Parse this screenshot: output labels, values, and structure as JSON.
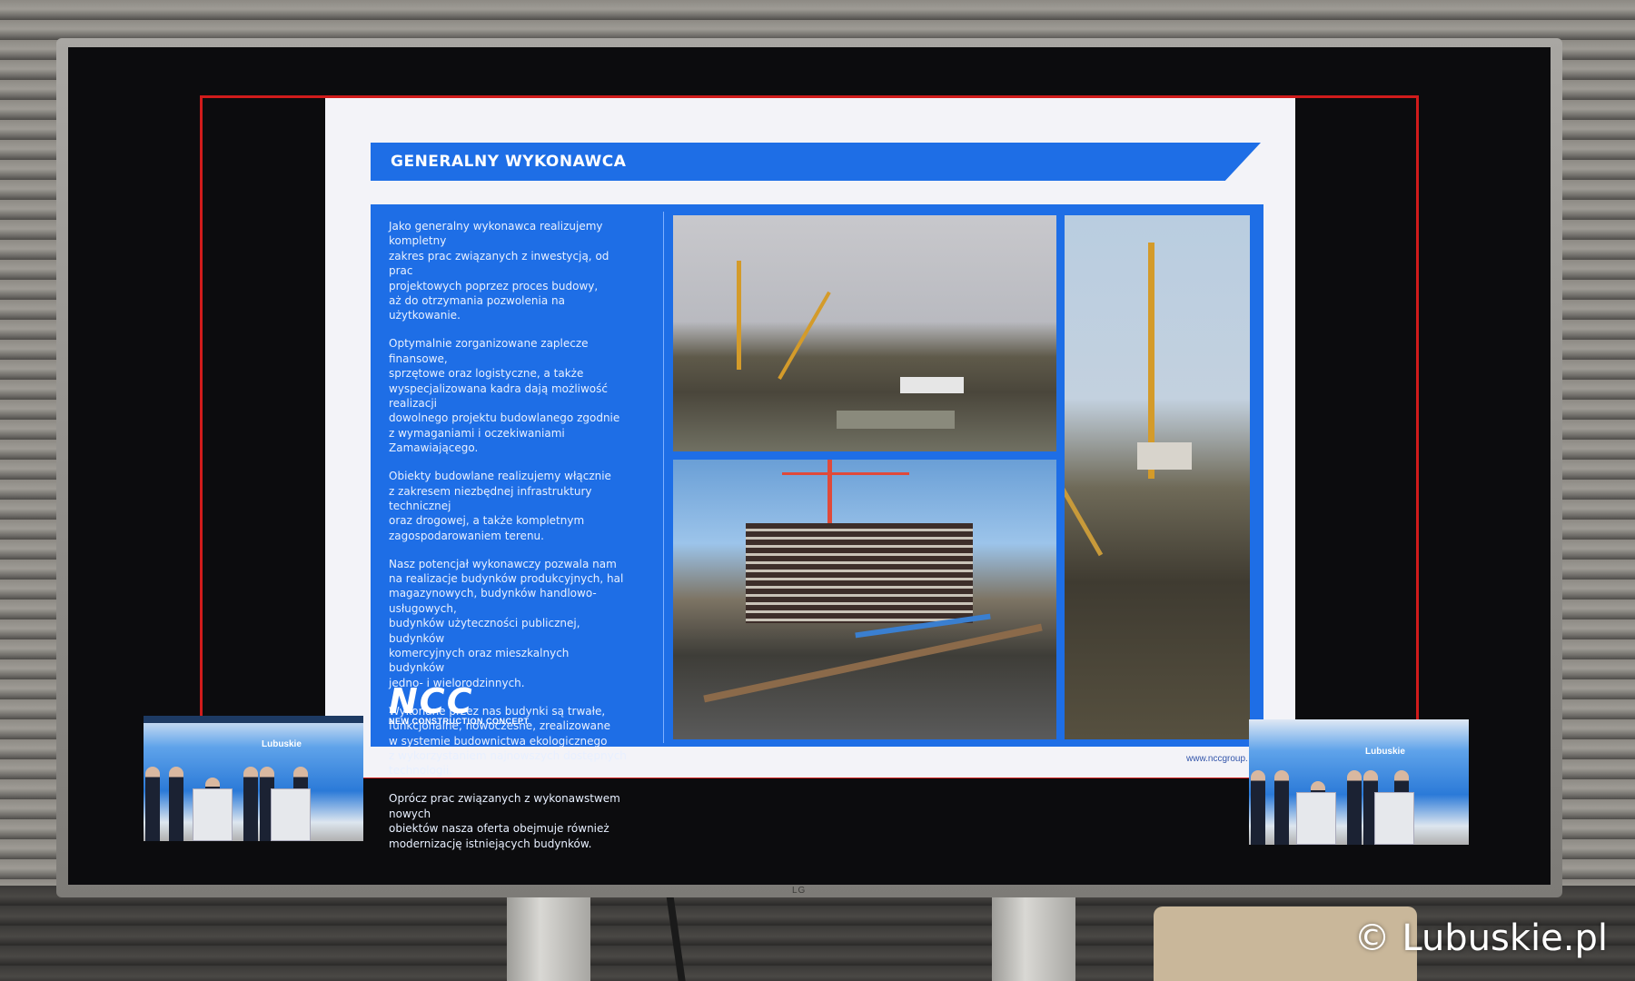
{
  "slide": {
    "title": "GENERALNY WYKONAWCA",
    "paragraphs": [
      "Jako generalny wykonawca realizujemy kompletny\nzakres prac związanych z inwestycją, od prac\nprojektowych poprzez proces budowy,\naż do otrzymania pozwolenia na użytkowanie.",
      "Optymalnie zorganizowane zaplecze finansowe,\nsprzętowe oraz logistyczne, a także\nwyspecjalizowana kadra dają możliwość realizacji\ndowolnego projektu budowlanego zgodnie\nz wymaganiami i oczekiwaniami Zamawiającego.",
      "Obiekty budowlane realizujemy  włącznie\nz zakresem niezbędnej infrastruktury technicznej\noraz drogowej, a także kompletnym\nzagospodarowaniem terenu.",
      "Nasz potencjał wykonawczy pozwala nam\nna realizacje budynków produkcyjnych, hal\nmagazynowych,  budynków handlowo-usługowych,\nbudynków użyteczności publicznej, budynków\nkomercyjnych oraz mieszkalnych budynków\njedno- i wielorodzinnych.",
      "Wykonane przez nas budynki są trwałe,\nfunkcjonalne, nowoczesne, zrealizowane\nw systemie budownictwa ekologicznego\nz wykorzystaniem najnowszych dostępnych\ntechnologii.",
      "Oprócz prac związanych z wykonawstwem nowych\nobiektów nasza oferta obejmuje również\nmodernizację istniejących budynków."
    ],
    "logo": {
      "mark": "NCC",
      "subtitle": "NEW CONSTRUCTION CONCEPT"
    },
    "url": "www.nccgroup."
  },
  "inset": {
    "sign": "Lubuskie"
  },
  "watermark": "© Lubuskie.pl",
  "tv_brand": "LG",
  "colors": {
    "slide_accent": "#1e6ee6",
    "frame_red": "#d11b1b"
  }
}
